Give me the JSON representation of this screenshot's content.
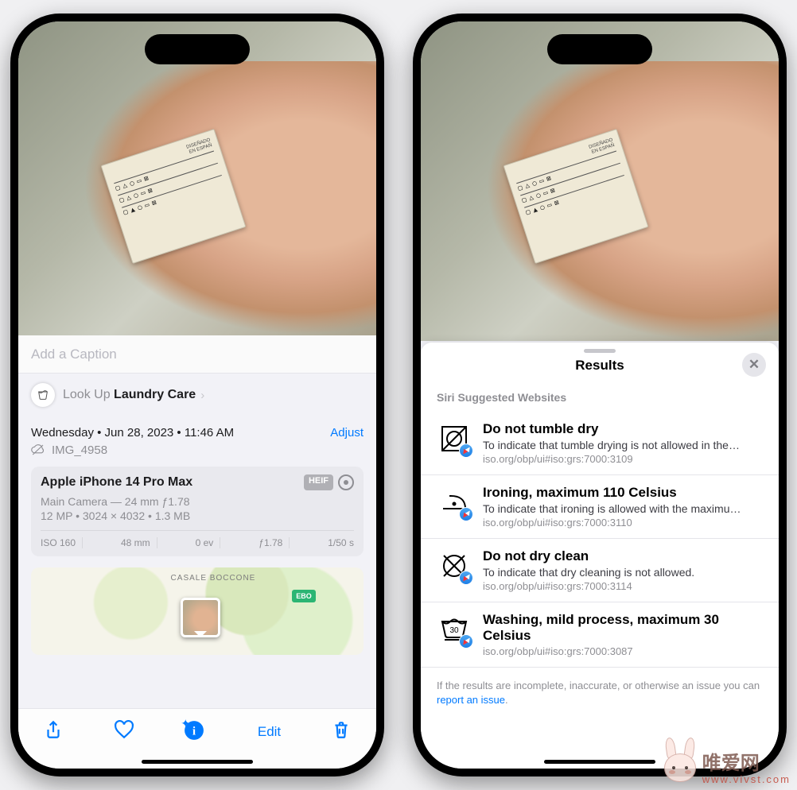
{
  "left": {
    "caption_placeholder": "Add a Caption",
    "lookup_prefix": "Look Up ",
    "lookup_subject": "Laundry Care",
    "date_line": "Wednesday • Jun 28, 2023 • 11:46 AM",
    "adjust_label": "Adjust",
    "filename": "IMG_4958",
    "camera": {
      "device": "Apple iPhone 14 Pro Max",
      "format_badge": "HEIF",
      "lens_line": "Main Camera — 24 mm ƒ1.78",
      "size_line": "12 MP • 3024 × 4032 • 1.3 MB",
      "stats": [
        "ISO 160",
        "48 mm",
        "0 ev",
        "ƒ1.78",
        "1/50 s"
      ]
    },
    "map": {
      "area": "CASALE BOCCONE",
      "marker": "EBO"
    },
    "toolbar": {
      "edit": "Edit"
    }
  },
  "right": {
    "sheet_title": "Results",
    "subtitle": "Siri Suggested Websites",
    "items": [
      {
        "title": "Do not tumble dry",
        "desc": "To indicate that tumble drying is not allowed in the…",
        "url": "iso.org/obp/ui#iso:grs:7000:3109"
      },
      {
        "title": "Ironing, maximum 110 Celsius",
        "desc": "To indicate that ironing is allowed with the maximu…",
        "url": "iso.org/obp/ui#iso:grs:7000:3110"
      },
      {
        "title": "Do not dry clean",
        "desc": "To indicate that dry cleaning is not allowed.",
        "url": "iso.org/obp/ui#iso:grs:7000:3114"
      },
      {
        "title": "Washing, mild process, maximum 30 Celsius",
        "desc": "",
        "url": "iso.org/obp/ui#iso:grs:7000:3087"
      }
    ],
    "footer_pre": "If the results are incomplete, inaccurate, or otherwise an issue you can ",
    "footer_link": "report an issue",
    "footer_post": "."
  },
  "watermark": {
    "top": "唯爱网",
    "bottom": "www.vivst.com"
  }
}
